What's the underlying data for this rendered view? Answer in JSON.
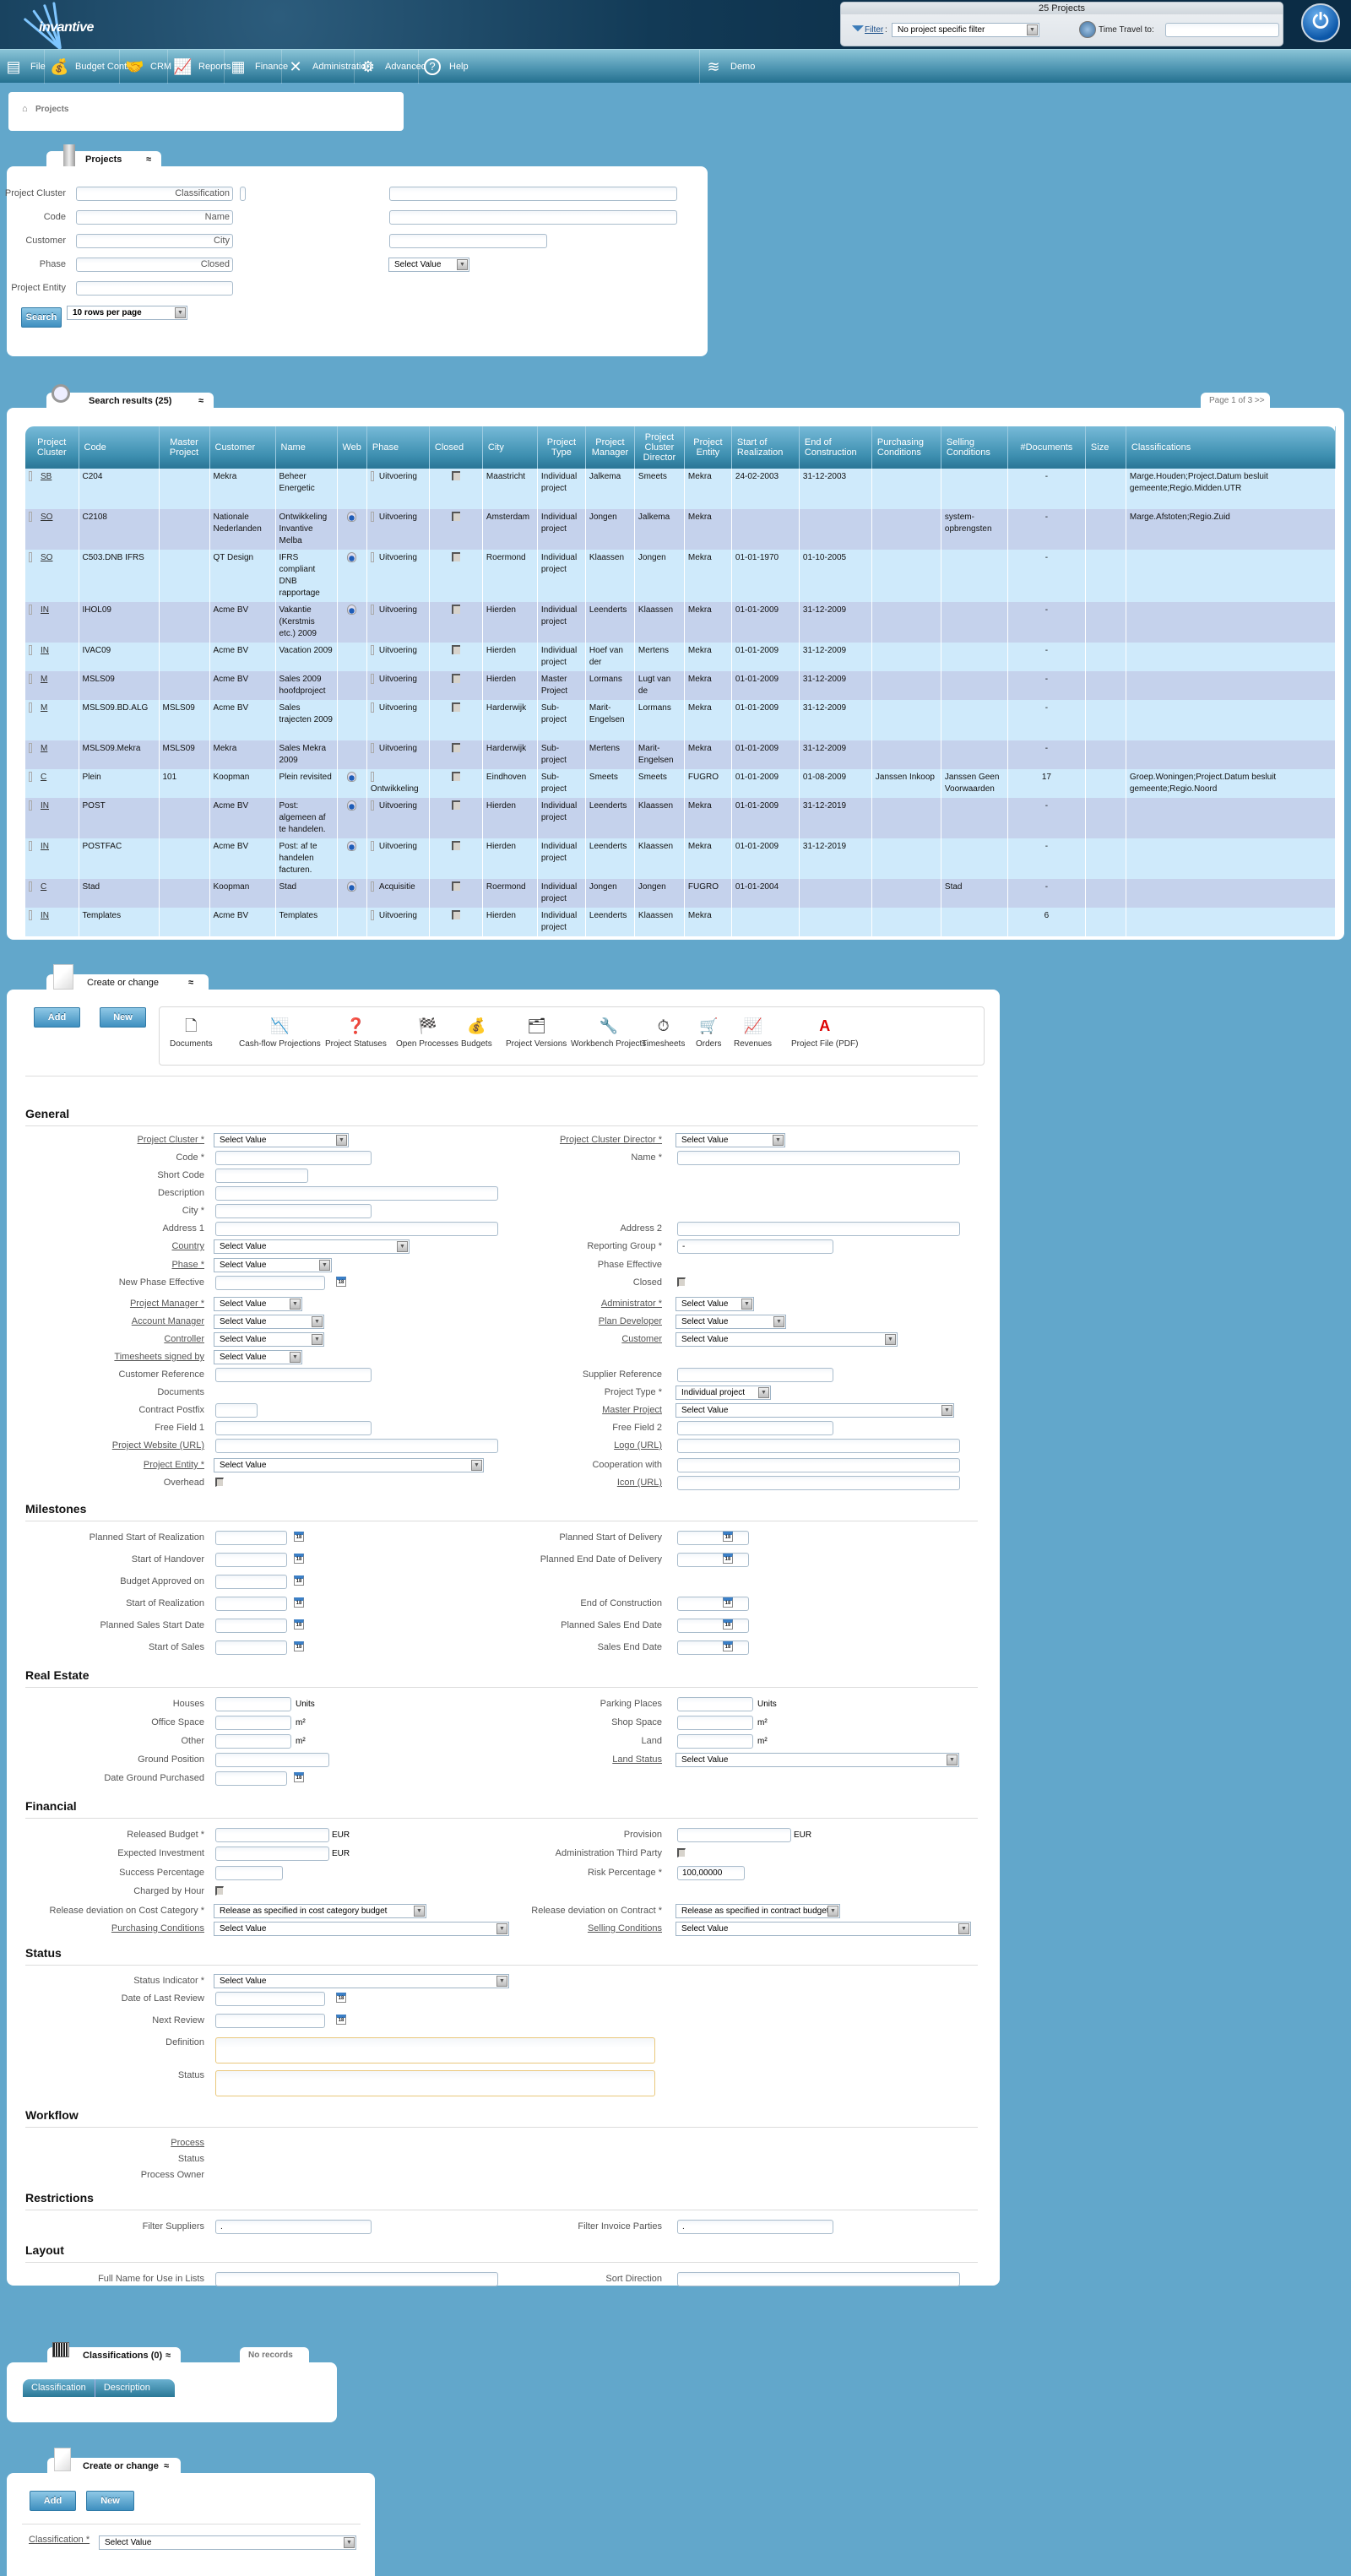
{
  "app": {
    "logo_text": "invantive",
    "projects_count": "25 Projects",
    "filter_label": "Filter",
    "filter_value": "No project specific filter",
    "time_travel_label": "Time Travel to:",
    "time_travel_value": ""
  },
  "nav": [
    {
      "label": "File",
      "icon": "cabinet-icon"
    },
    {
      "label": "Budget Control",
      "icon": "money-bag-icon"
    },
    {
      "label": "CRM",
      "icon": "handshake-icon"
    },
    {
      "label": "Reports",
      "icon": "presentation-chart-icon"
    },
    {
      "label": "Finance",
      "icon": "calculator-icon"
    },
    {
      "label": "Administration",
      "icon": "tools-icon"
    },
    {
      "label": "Advanced",
      "icon": "gears-icon"
    },
    {
      "label": "Help",
      "icon": "help-icon"
    },
    {
      "label": "Demo",
      "icon": "invantive-logo-icon"
    }
  ],
  "breadcrumb": {
    "label": "Projects"
  },
  "search_panel": {
    "tab_title": "Projects",
    "fields_left": [
      "Project Cluster",
      "Code",
      "Customer",
      "Phase",
      "Project Entity"
    ],
    "fields_right": [
      "Classification",
      "Name",
      "City",
      "Closed"
    ],
    "closed_value": "Select Value",
    "search_button": "Search",
    "rows_per_page": "10 rows per page"
  },
  "results": {
    "tab_title": "Search results (25)",
    "pager": "Page 1 of 3 >> >|",
    "columns": [
      "Project Cluster",
      "Code",
      "Master Project",
      "Customer",
      "Name",
      "Web",
      "Phase",
      "Closed",
      "City",
      "Project Type",
      "Project Manager",
      "Project Cluster Director",
      "Project Entity",
      "Start of Realization",
      "End of Construction",
      "Purchasing Conditions",
      "Selling Conditions",
      "#Documents",
      "Size",
      "Classifications"
    ],
    "rows": [
      {
        "cluster": "SB",
        "code": "C204",
        "master": "",
        "customer": "Mekra",
        "name": "Beheer Energetic",
        "web": false,
        "phase": "Uitvoering",
        "city": "Maastricht",
        "type": "Individual project",
        "manager": "Jalkema",
        "director": "Smeets",
        "entity": "Mekra",
        "start": "24-02-2003",
        "end": "31-12-2003",
        "purchasing": "",
        "selling": "",
        "docs": "-",
        "size": "",
        "classifications": "Marge.Houden;Project.Datum besluit gemeente;Regio.Midden.UTR"
      },
      {
        "cluster": "SO",
        "code": "C2108",
        "master": "",
        "customer": "Nationale Nederlanden",
        "name": "Ontwikkeling Invantive Melba",
        "web": true,
        "phase": "Uitvoering",
        "city": "Amsterdam",
        "type": "Individual project",
        "manager": "Jongen",
        "director": "Jalkema",
        "entity": "Mekra",
        "start": "",
        "end": "",
        "purchasing": "",
        "selling": "system-opbrengsten",
        "docs": "-",
        "size": "",
        "classifications": "Marge.Afstoten;Regio.Zuid"
      },
      {
        "cluster": "SO",
        "code": "C503.DNB IFRS",
        "master": "",
        "customer": "QT Design",
        "name": "IFRS compliant DNB rapportage",
        "web": true,
        "phase": "Uitvoering",
        "city": "Roermond",
        "type": "Individual project",
        "manager": "Klaassen",
        "director": "Jongen",
        "entity": "Mekra",
        "start": "01-01-1970",
        "end": "01-10-2005",
        "purchasing": "",
        "selling": "",
        "docs": "-",
        "size": "",
        "classifications": ""
      },
      {
        "cluster": "IN",
        "code": "IHOL09",
        "master": "",
        "customer": "Acme BV",
        "name": "Vakantie (Kerstmis etc.) 2009",
        "web": true,
        "phase": "Uitvoering",
        "city": "Hierden",
        "type": "Individual project",
        "manager": "Leenderts",
        "director": "Klaassen",
        "entity": "Mekra",
        "start": "01-01-2009",
        "end": "31-12-2009",
        "purchasing": "",
        "selling": "",
        "docs": "-",
        "size": "",
        "classifications": ""
      },
      {
        "cluster": "IN",
        "code": "IVAC09",
        "master": "",
        "customer": "Acme BV",
        "name": "Vacation 2009",
        "web": false,
        "phase": "Uitvoering",
        "city": "Hierden",
        "type": "Individual project",
        "manager": "Hoef van der",
        "director": "Mertens",
        "entity": "Mekra",
        "start": "01-01-2009",
        "end": "31-12-2009",
        "purchasing": "",
        "selling": "",
        "docs": "-",
        "size": "",
        "classifications": ""
      },
      {
        "cluster": "M",
        "code": "MSLS09",
        "master": "",
        "customer": "Acme BV",
        "name": "Sales 2009 hoofdproject",
        "web": false,
        "phase": "Uitvoering",
        "city": "Hierden",
        "type": "Master Project",
        "manager": "Lormans",
        "director": "Lugt van de",
        "entity": "Mekra",
        "start": "01-01-2009",
        "end": "31-12-2009",
        "purchasing": "",
        "selling": "",
        "docs": "-",
        "size": "",
        "classifications": ""
      },
      {
        "cluster": "M",
        "code": "MSLS09.BD.ALG",
        "master": "MSLS09",
        "customer": "Acme BV",
        "name": "Sales trajecten 2009",
        "web": false,
        "phase": "Uitvoering",
        "city": "Harderwijk",
        "type": "Sub-project",
        "manager": "Marit-Engelsen",
        "director": "Lormans",
        "entity": "Mekra",
        "start": "01-01-2009",
        "end": "31-12-2009",
        "purchasing": "",
        "selling": "",
        "docs": "-",
        "size": "",
        "classifications": ""
      },
      {
        "cluster": "M",
        "code": "MSLS09.Mekra",
        "master": "MSLS09",
        "customer": "Mekra",
        "name": "Sales Mekra 2009",
        "web": false,
        "phase": "Uitvoering",
        "city": "Harderwijk",
        "type": "Sub-project",
        "manager": "Mertens",
        "director": "Marit-Engelsen",
        "entity": "Mekra",
        "start": "01-01-2009",
        "end": "31-12-2009",
        "purchasing": "",
        "selling": "",
        "docs": "-",
        "size": "",
        "classifications": ""
      },
      {
        "cluster": "C",
        "code": "Plein",
        "master": "101",
        "customer": "Koopman",
        "name": "Plein revisited",
        "web": true,
        "phase": "Ontwikkeling",
        "city": "Eindhoven",
        "type": "Sub-project",
        "manager": "Smeets",
        "director": "Smeets",
        "entity": "FUGRO",
        "start": "01-01-2009",
        "end": "01-08-2009",
        "purchasing": "Janssen Inkoop",
        "selling": "Janssen Geen Voorwaarden",
        "docs": "17",
        "size": "",
        "classifications": "Groep.Woningen;Project.Datum besluit gemeente;Regio.Noord"
      },
      {
        "cluster": "IN",
        "code": "POST",
        "master": "",
        "customer": "Acme BV",
        "name": "Post: algemeen af te handelen.",
        "web": true,
        "phase": "Uitvoering",
        "city": "Hierden",
        "type": "Individual project",
        "manager": "Leenderts",
        "director": "Klaassen",
        "entity": "Mekra",
        "start": "01-01-2009",
        "end": "31-12-2019",
        "purchasing": "",
        "selling": "",
        "docs": "-",
        "size": "",
        "classifications": ""
      },
      {
        "cluster": "IN",
        "code": "POSTFAC",
        "master": "",
        "customer": "Acme BV",
        "name": "Post: af te handelen facturen.",
        "web": true,
        "phase": "Uitvoering",
        "city": "Hierden",
        "type": "Individual project",
        "manager": "Leenderts",
        "director": "Klaassen",
        "entity": "Mekra",
        "start": "01-01-2009",
        "end": "31-12-2019",
        "purchasing": "",
        "selling": "",
        "docs": "-",
        "size": "",
        "classifications": ""
      },
      {
        "cluster": "C",
        "code": "Stad",
        "master": "",
        "customer": "Koopman",
        "name": "Stad",
        "web": true,
        "phase": "Acquisitie",
        "city": "Roermond",
        "type": "Individual project",
        "manager": "Jongen",
        "director": "Jongen",
        "entity": "FUGRO",
        "start": "01-01-2004",
        "end": "",
        "purchasing": "",
        "selling": "Stad",
        "docs": "-",
        "size": "",
        "classifications": ""
      },
      {
        "cluster": "IN",
        "code": "Templates",
        "master": "",
        "customer": "Acme BV",
        "name": "Templates",
        "web": false,
        "phase": "Uitvoering",
        "city": "Hierden",
        "type": "Individual project",
        "manager": "Leenderts",
        "director": "Klaassen",
        "entity": "Mekra",
        "start": "",
        "end": "",
        "purchasing": "",
        "selling": "",
        "docs": "6",
        "size": "",
        "classifications": ""
      }
    ]
  },
  "create": {
    "tab_title": "Create or change",
    "add_button": "Add",
    "new_button": "New",
    "tools": [
      {
        "label": "Documents",
        "icon": "document-icon"
      },
      {
        "label": "Cash-flow Projections",
        "icon": "cashflow-chart-icon"
      },
      {
        "label": "Project Statuses",
        "icon": "project-status-icon"
      },
      {
        "label": "Open Processes",
        "icon": "checkered-flag-icon"
      },
      {
        "label": "Budgets",
        "icon": "money-bag-icon"
      },
      {
        "label": "Project Versions",
        "icon": "versions-icon"
      },
      {
        "label": "Workbench Projects",
        "icon": "workbench-icon"
      },
      {
        "label": "Timesheets",
        "icon": "stopwatch-icon"
      },
      {
        "label": "Orders",
        "icon": "shopping-cart-icon"
      },
      {
        "label": "Revenues",
        "icon": "revenue-chart-icon"
      },
      {
        "label": "Project File (PDF)",
        "icon": "adobe-pdf-icon"
      }
    ],
    "select_placeholder": "Select Value",
    "sections": {
      "general": "General",
      "milestones": "Milestones",
      "real_estate": "Real Estate",
      "financial": "Financial",
      "status": "Status",
      "workflow": "Workflow",
      "restrictions": "Restrictions",
      "layout": "Layout"
    },
    "general": {
      "project_cluster": "Project Cluster *",
      "project_cluster_director": "Project Cluster Director *",
      "code": "Code *",
      "name": "Name *",
      "short_code": "Short Code",
      "description": "Description",
      "city": "City *",
      "address1": "Address 1",
      "address2": "Address 2",
      "country": "Country",
      "reporting_group": "Reporting Group *",
      "reporting_group_value": "-",
      "phase": "Phase *",
      "phase_effective": "Phase Effective",
      "new_phase_effective": "New Phase Effective",
      "closed": "Closed",
      "project_manager": "Project Manager *",
      "administrator": "Administrator *",
      "account_manager": "Account Manager",
      "plan_developer": "Plan Developer",
      "controller": "Controller",
      "customer": "Customer",
      "timesheets_signed_by": "Timesheets signed by",
      "customer_reference": "Customer Reference",
      "supplier_reference": "Supplier Reference",
      "documents": "Documents",
      "project_type": "Project Type *",
      "project_type_value": "Individual project",
      "contract_postfix": "Contract Postfix",
      "master_project": "Master Project",
      "free_field1": "Free Field 1",
      "free_field2": "Free Field 2",
      "project_website": "Project Website (URL)",
      "logo_url": "Logo (URL)",
      "project_entity": "Project Entity *",
      "cooperation_with": "Cooperation with",
      "overhead": "Overhead",
      "icon_url": "Icon (URL)"
    },
    "milestones": {
      "left": [
        "Planned Start of Realization",
        "Start of Handover",
        "Budget Approved on",
        "Start of Realization",
        "Planned Sales Start Date",
        "Start of Sales"
      ],
      "right": [
        "Planned Start of Delivery",
        "Planned End Date of Delivery",
        "",
        "End of Construction",
        "Planned Sales End Date",
        "Sales End Date"
      ]
    },
    "real_estate": {
      "houses": "Houses",
      "parking": "Parking Places",
      "office": "Office Space",
      "shop": "Shop Space",
      "other": "Other",
      "land": "Land",
      "ground_position": "Ground Position",
      "land_status": "Land Status",
      "date_ground": "Date Ground Purchased",
      "unit_units": "Units",
      "unit_m2": "m²"
    },
    "financial": {
      "released_budget": "Released Budget *",
      "provision": "Provision",
      "currency": "EUR",
      "expected_investment": "Expected Investment",
      "admin_third_party": "Administration Third Party",
      "success_percentage": "Success Percentage",
      "risk_percentage": "Risk Percentage *",
      "risk_value": "100,00000",
      "charged_by_hour": "Charged by Hour",
      "release_dev_cost": "Release deviation on Cost Category *",
      "release_dev_cost_value": "Release as specified in cost category budget",
      "release_dev_contract": "Release deviation on Contract *",
      "release_dev_contract_value": "Release as specified in contract budget",
      "purchasing_conditions": "Purchasing Conditions",
      "selling_conditions": "Selling Conditions"
    },
    "status": {
      "status_indicator": "Status Indicator *",
      "date_last_review": "Date of Last Review",
      "next_review": "Next Review",
      "definition": "Definition",
      "status": "Status"
    },
    "workflow": {
      "process": "Process",
      "status": "Status",
      "process_owner": "Process Owner"
    },
    "restrictions": {
      "filter_suppliers": "Filter Suppliers",
      "filter_suppliers_value": ".",
      "filter_invoice": "Filter Invoice Parties",
      "filter_invoice_value": "."
    },
    "layout": {
      "full_name": "Full Name for Use in Lists",
      "sort_direction": "Sort Direction"
    }
  },
  "classifications": {
    "tab_title": "Classifications (0)",
    "no_records": "No records",
    "columns": [
      "Classification",
      "Description"
    ]
  },
  "create2": {
    "tab_title": "Create or change",
    "add_button": "Add",
    "new_button": "New",
    "classification_label": "Classification *",
    "classification_value": "Select Value"
  },
  "calendar_day": "18"
}
